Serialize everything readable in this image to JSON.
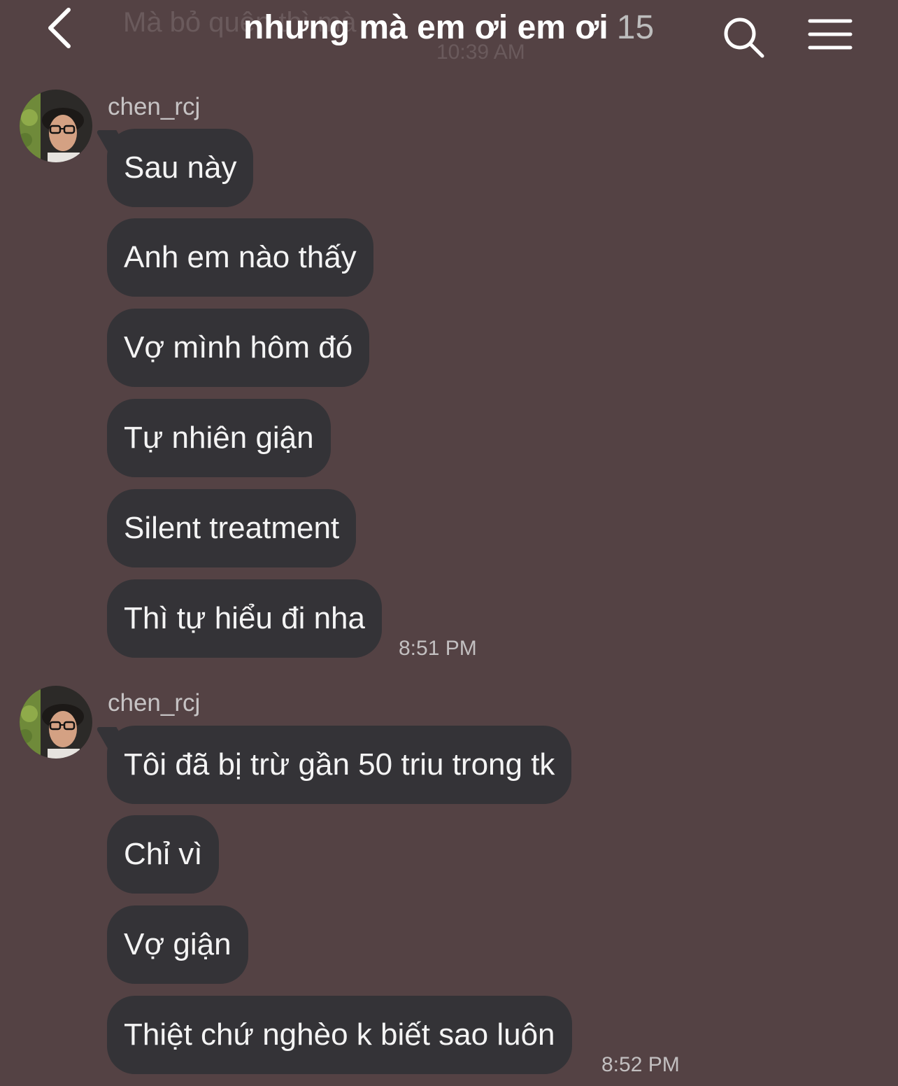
{
  "header": {
    "ghost_preview": "Mà bỏ quên thì mà",
    "ghost_time": "10:39 AM",
    "title": "nhưng mà em ơi em ơi",
    "member_count": "15",
    "back_icon": "chevron-left-icon",
    "search_icon": "search-icon",
    "menu_icon": "hamburger-menu-icon"
  },
  "colors": {
    "background": "#544244",
    "bubble": "#343337"
  },
  "groups": [
    {
      "sender": "chen_rcj",
      "messages": [
        "Sau này",
        "Anh em nào thấy",
        "Vợ mình hôm đó",
        "Tự nhiên giận",
        "Silent treatment",
        "Thì tự hiểu đi nha"
      ],
      "time": "8:51 PM"
    },
    {
      "sender": "chen_rcj",
      "messages": [
        "Tôi đã bị trừ gần 50 triu trong tk",
        "Chỉ vì",
        "Vợ giận",
        "Thiệt chứ nghèo k biết sao luôn"
      ],
      "time": "8:52 PM"
    }
  ]
}
